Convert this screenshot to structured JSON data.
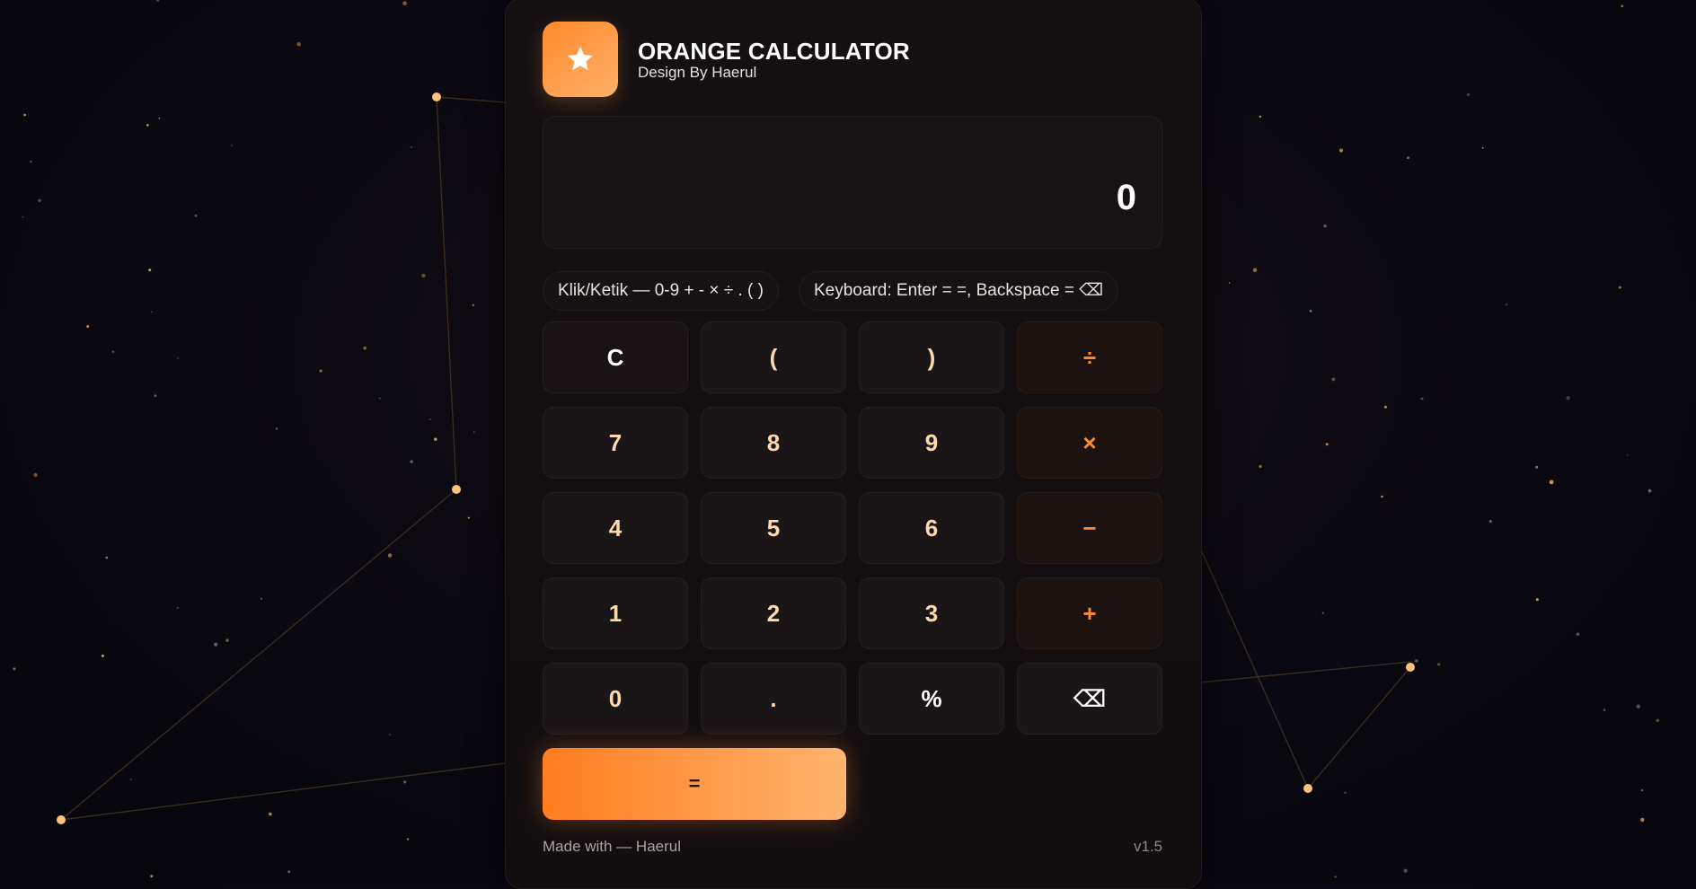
{
  "app": {
    "title": "ORANGE CALCULATOR",
    "subtitle": "Design By Haerul",
    "logo_icon": "star-icon",
    "accent_color": "#ff8a2b"
  },
  "display": {
    "value": "0"
  },
  "hints": [
    "Klik/Ketik — 0-9 + - × ÷ . ( )",
    "Keyboard: Enter = =, Backspace = ⌫"
  ],
  "keys": [
    {
      "label": "C",
      "kind": "clear"
    },
    {
      "label": "(",
      "kind": "num"
    },
    {
      "label": ")",
      "kind": "num"
    },
    {
      "label": "÷",
      "kind": "op"
    },
    {
      "label": "7",
      "kind": "num"
    },
    {
      "label": "8",
      "kind": "num"
    },
    {
      "label": "9",
      "kind": "num"
    },
    {
      "label": "×",
      "kind": "op"
    },
    {
      "label": "4",
      "kind": "num"
    },
    {
      "label": "5",
      "kind": "num"
    },
    {
      "label": "6",
      "kind": "num"
    },
    {
      "label": "−",
      "kind": "op"
    },
    {
      "label": "1",
      "kind": "num"
    },
    {
      "label": "2",
      "kind": "num"
    },
    {
      "label": "3",
      "kind": "num"
    },
    {
      "label": "+",
      "kind": "op"
    },
    {
      "label": "0",
      "kind": "num"
    },
    {
      "label": ".",
      "kind": "num"
    },
    {
      "label": "%",
      "kind": "plain"
    },
    {
      "label": "⌫",
      "kind": "plain"
    }
  ],
  "equals_label": "=",
  "footer": {
    "credit": "Made with — Haerul",
    "version": "v1.5"
  }
}
